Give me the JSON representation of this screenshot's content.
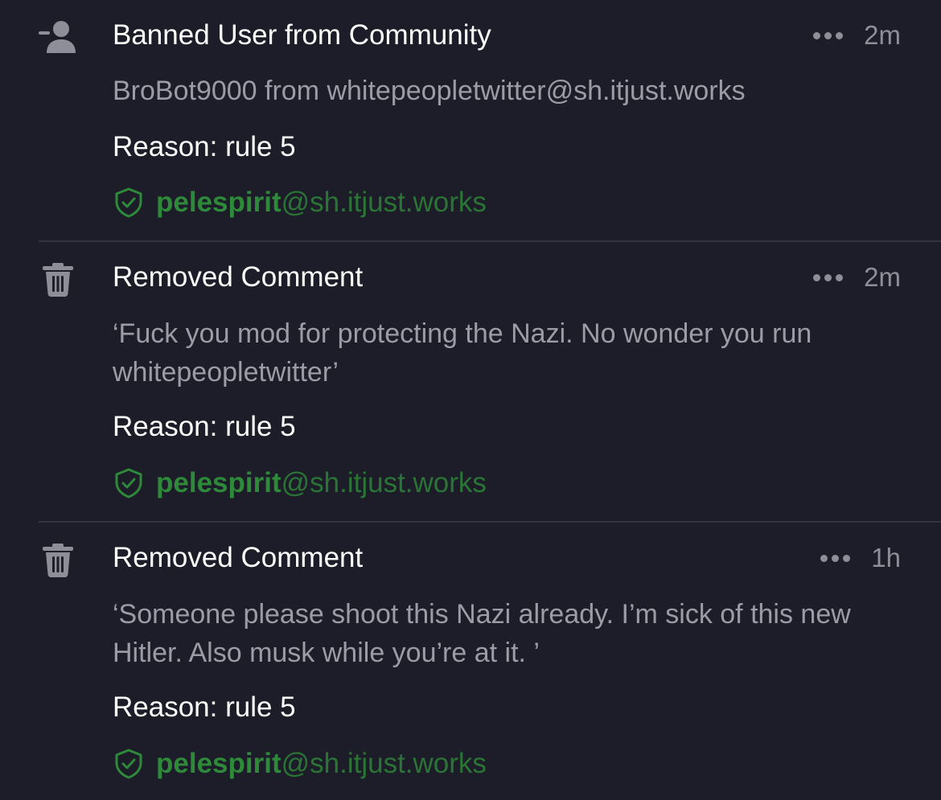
{
  "entries": [
    {
      "icon": "remove-user-icon",
      "title": "Banned User from Community",
      "time": "2m",
      "body": "BroBot9000 from whitepeopletwitter@sh.itjust.works",
      "reason": "Reason: rule 5",
      "moderator": {
        "name": "pelespirit",
        "host": "@sh.itjust.works"
      }
    },
    {
      "icon": "trash-icon",
      "title": "Removed Comment",
      "time": "2m",
      "body": "‘Fuck you mod for protecting the Nazi. No wonder you run whitepeopletwitter’",
      "reason": "Reason: rule 5",
      "moderator": {
        "name": "pelespirit",
        "host": "@sh.itjust.works"
      }
    },
    {
      "icon": "trash-icon",
      "title": "Removed Comment",
      "time": "1h",
      "body": "‘Someone please shoot this Nazi already. I’m sick of this new Hitler. Also musk while you’re at it. ’",
      "reason": "Reason: rule 5",
      "moderator": {
        "name": "pelespirit",
        "host": "@sh.itjust.works"
      }
    }
  ],
  "colors": {
    "background": "#1c1d28",
    "title": "#ffffff",
    "body": "#9c9ca6",
    "muted": "#8e8e99",
    "moderator": "#2e8a3a",
    "divider": "#34353f"
  }
}
